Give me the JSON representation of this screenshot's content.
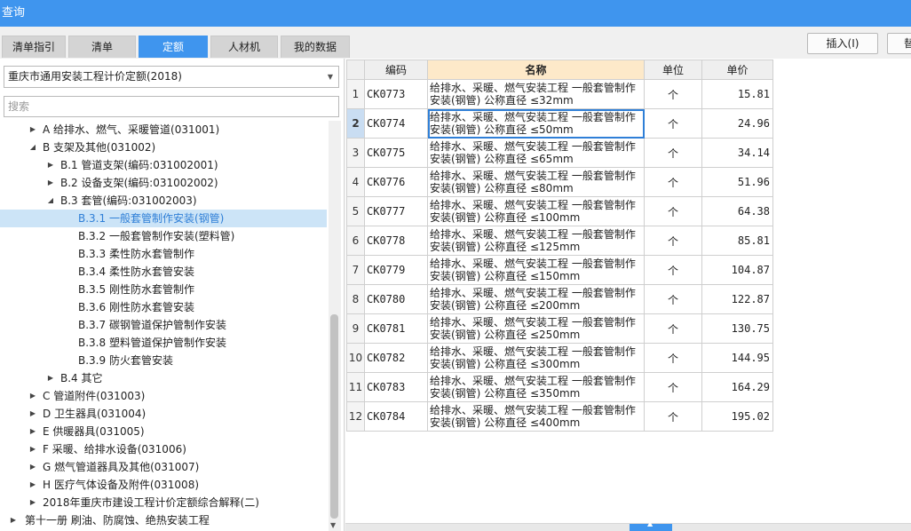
{
  "window": {
    "title": "查询"
  },
  "tabs": [
    {
      "label": "清单指引",
      "active": false
    },
    {
      "label": "清单",
      "active": false
    },
    {
      "label": "定额",
      "active": true
    },
    {
      "label": "人材机",
      "active": false
    },
    {
      "label": "我的数据",
      "active": false
    }
  ],
  "toolbar": {
    "insert_label": "插入(I)",
    "replace_label": "替"
  },
  "library_select": {
    "value": "重庆市通用安装工程计价定额(2018)"
  },
  "search": {
    "placeholder": "搜索"
  },
  "tree": [
    {
      "label": "A 给排水、燃气、采暖管道(031001)",
      "arrow": "right"
    },
    {
      "label": "B 支架及其他(031002)",
      "arrow": "down"
    },
    {
      "label": "B.1 管道支架(编码:031002001)",
      "arrow": "right"
    },
    {
      "label": "B.2 设备支架(编码:031002002)",
      "arrow": "right"
    },
    {
      "label": "B.3 套管(编码:031002003)",
      "arrow": "down"
    },
    {
      "label": "B.3.1 一般套管制作安装(钢管)",
      "arrow": ""
    },
    {
      "label": "B.3.2 一般套管制作安装(塑料管)",
      "arrow": ""
    },
    {
      "label": "B.3.3 柔性防水套管制作",
      "arrow": ""
    },
    {
      "label": "B.3.4 柔性防水套管安装",
      "arrow": ""
    },
    {
      "label": "B.3.5 刚性防水套管制作",
      "arrow": ""
    },
    {
      "label": "B.3.6 刚性防水套管安装",
      "arrow": ""
    },
    {
      "label": "B.3.7 碳钢管道保护管制作安装",
      "arrow": ""
    },
    {
      "label": "B.3.8 塑料管道保护管制作安装",
      "arrow": ""
    },
    {
      "label": "B.3.9 防火套管安装",
      "arrow": ""
    },
    {
      "label": "B.4 其它",
      "arrow": "right"
    },
    {
      "label": "C 管道附件(031003)",
      "arrow": "right"
    },
    {
      "label": "D 卫生器具(031004)",
      "arrow": "right"
    },
    {
      "label": "E 供暖器具(031005)",
      "arrow": "right"
    },
    {
      "label": "F 采暖、给排水设备(031006)",
      "arrow": "right"
    },
    {
      "label": "G 燃气管道器具及其他(031007)",
      "arrow": "right"
    },
    {
      "label": "H 医疗气体设备及附件(031008)",
      "arrow": "right"
    },
    {
      "label": "2018年重庆市建设工程计价定额综合解释(二)",
      "arrow": "right"
    },
    {
      "label": "第十一册 刷油、防腐蚀、绝热安装工程",
      "arrow": "right"
    }
  ],
  "grid": {
    "columns": {
      "code": "编码",
      "name": "名称",
      "unit": "单位",
      "price": "单价"
    },
    "rows": [
      {
        "n": "1",
        "code": "CK0773",
        "name1": "给排水、采暖、燃气安装工程 一般套管制作",
        "name2": "安装(钢管) 公称直径 ≤32mm",
        "unit": "个",
        "price": "15.81"
      },
      {
        "n": "2",
        "code": "CK0774",
        "name1": "给排水、采暖、燃气安装工程 一般套管制作",
        "name2": "安装(钢管) 公称直径 ≤50mm",
        "unit": "个",
        "price": "24.96"
      },
      {
        "n": "3",
        "code": "CK0775",
        "name1": "给排水、采暖、燃气安装工程 一般套管制作",
        "name2": "安装(钢管) 公称直径 ≤65mm",
        "unit": "个",
        "price": "34.14"
      },
      {
        "n": "4",
        "code": "CK0776",
        "name1": "给排水、采暖、燃气安装工程 一般套管制作",
        "name2": "安装(钢管) 公称直径 ≤80mm",
        "unit": "个",
        "price": "51.96"
      },
      {
        "n": "5",
        "code": "CK0777",
        "name1": "给排水、采暖、燃气安装工程 一般套管制作",
        "name2": "安装(钢管) 公称直径 ≤100mm",
        "unit": "个",
        "price": "64.38"
      },
      {
        "n": "6",
        "code": "CK0778",
        "name1": "给排水、采暖、燃气安装工程 一般套管制作",
        "name2": "安装(钢管) 公称直径 ≤125mm",
        "unit": "个",
        "price": "85.81"
      },
      {
        "n": "7",
        "code": "CK0779",
        "name1": "给排水、采暖、燃气安装工程 一般套管制作",
        "name2": "安装(钢管) 公称直径 ≤150mm",
        "unit": "个",
        "price": "104.87"
      },
      {
        "n": "8",
        "code": "CK0780",
        "name1": "给排水、采暖、燃气安装工程 一般套管制作",
        "name2": "安装(钢管) 公称直径 ≤200mm",
        "unit": "个",
        "price": "122.87"
      },
      {
        "n": "9",
        "code": "CK0781",
        "name1": "给排水、采暖、燃气安装工程 一般套管制作",
        "name2": "安装(钢管) 公称直径 ≤250mm",
        "unit": "个",
        "price": "130.75"
      },
      {
        "n": "10",
        "code": "CK0782",
        "name1": "给排水、采暖、燃气安装工程 一般套管制作",
        "name2": "安装(钢管) 公称直径 ≤300mm",
        "unit": "个",
        "price": "144.95"
      },
      {
        "n": "11",
        "code": "CK0783",
        "name1": "给排水、采暖、燃气安装工程 一般套管制作",
        "name2": "安装(钢管) 公称直径 ≤350mm",
        "unit": "个",
        "price": "164.29"
      },
      {
        "n": "12",
        "code": "CK0784",
        "name1": "给排水、采暖、燃气安装工程 一般套管制作",
        "name2": "安装(钢管) 公称直径 ≤400mm",
        "unit": "个",
        "price": "195.02"
      }
    ]
  },
  "colors": {
    "accent": "#3f95ee",
    "selection": "#cce4f7",
    "header_highlight": "#fde9c9"
  }
}
